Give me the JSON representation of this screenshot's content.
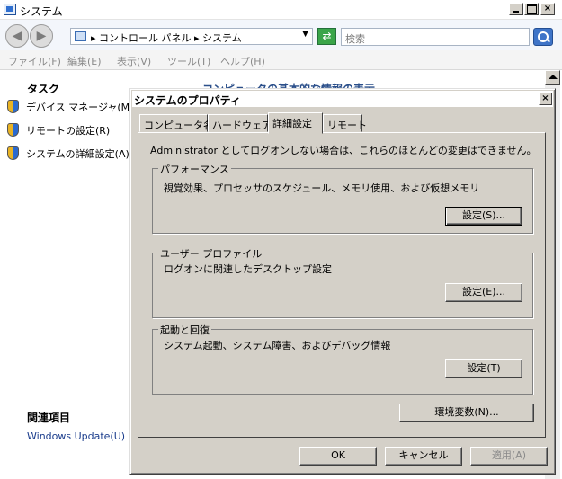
{
  "window": {
    "title": "システム"
  },
  "address": {
    "path": "▸ コントロール パネル ▸ システム",
    "search_placeholder": "検索"
  },
  "menu": [
    "ファイル(F)",
    "編集(E)",
    "表示(V)",
    "ツール(T)",
    "ヘルプ(H)"
  ],
  "left_pane": {
    "tasks_header": "タスク",
    "tasks": [
      "デバイス マネージャ(M)",
      "リモートの設定(R)",
      "システムの詳細設定(A)"
    ],
    "related_header": "関連項目",
    "related_links": [
      "Windows Update(U)"
    ]
  },
  "background_heading": "コンピュータの基本的な情報の表示",
  "dialog": {
    "title": "システムのプロパティ",
    "close_glyph": "×",
    "tabs": [
      "コンピュータ名",
      "ハードウェア",
      "詳細設定",
      "リモート"
    ],
    "active_tab": "詳細設定",
    "notice": "Administrator としてログオンしない場合は、これらのほとんどの変更はできません。",
    "groups": {
      "performance": {
        "label": "パフォーマンス",
        "description": "視覚効果、プロセッサのスケジュール、メモリ使用、および仮想メモリ",
        "button": "設定(S)..."
      },
      "profile": {
        "label": "ユーザー プロファイル",
        "description": "ログオンに関連したデスクトップ設定",
        "button": "設定(E)..."
      },
      "startup": {
        "label": "起動と回復",
        "description": "システム起動、システム障害、およびデバッグ情報",
        "button": "設定(T)"
      }
    },
    "env_button": "環境変数(N)...",
    "ok_button": "OK",
    "cancel_button": "キャンセル",
    "apply_button": "適用(A)"
  }
}
